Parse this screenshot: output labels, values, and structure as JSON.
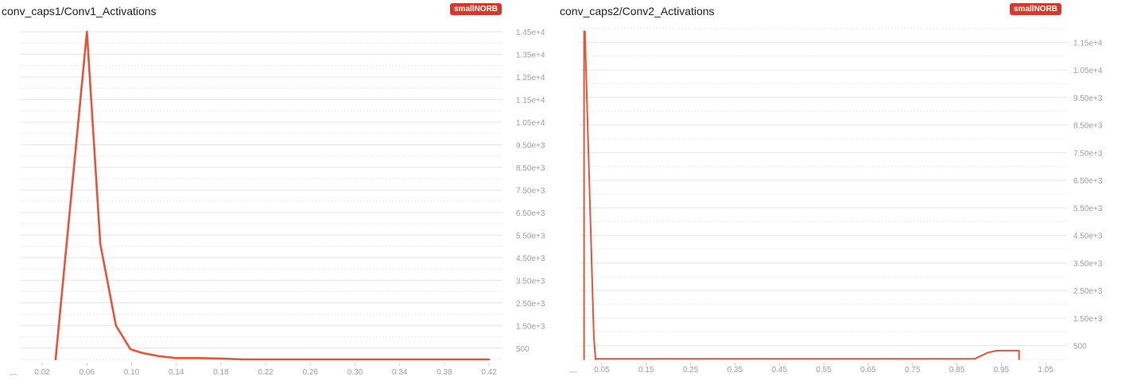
{
  "charts": [
    {
      "title": "conv_caps1/Conv1_Activations",
      "run_tag": "smallNORB",
      "tag_color": "#d13b2f"
    },
    {
      "title": "conv_caps2/Conv2_Activations",
      "run_tag": "smallNORB",
      "tag_color": "#d13b2f"
    }
  ],
  "chart_data": [
    {
      "type": "line",
      "title": "conv_caps1/Conv1_Activations",
      "xlabel": "",
      "ylabel": "",
      "xlim": [
        0.0,
        0.432
      ],
      "ylim": [
        0,
        14500
      ],
      "x_ticks": [
        0.02,
        0.06,
        0.1,
        0.14,
        0.18,
        0.22,
        0.26,
        0.3,
        0.34,
        0.38,
        0.42
      ],
      "x_tick_labels": [
        "0.02",
        "0.06",
        "0.10",
        "0.14",
        "0.18",
        "0.22",
        "0.26",
        "0.30",
        "0.34",
        "0.38",
        "0.42"
      ],
      "y_ticks": [
        500,
        1500,
        2500,
        3500,
        4500,
        5500,
        6500,
        7500,
        8500,
        9500,
        10500,
        11500,
        12500,
        13500,
        14500
      ],
      "y_tick_labels": [
        "500",
        "1.50e+3",
        "2.50e+3",
        "3.50e+3",
        "4.50e+3",
        "5.50e+3",
        "6.50e+3",
        "7.50e+3",
        "8.50e+3",
        "9.50e+3",
        "1.05e+4",
        "1.15e+4",
        "1.25e+4",
        "1.35e+4",
        "1.45e+4"
      ],
      "grid": true,
      "color": "#e8543a",
      "series": [
        {
          "x": [
            0.032,
            0.0325,
            0.06,
            0.072,
            0.086,
            0.099,
            0.11,
            0.125,
            0.14,
            0.16,
            0.18,
            0.2,
            0.42
          ],
          "values": [
            0,
            300,
            14500,
            5100,
            1500,
            450,
            280,
            140,
            60,
            60,
            40,
            0,
            0
          ]
        }
      ]
    },
    {
      "type": "line",
      "title": "conv_caps2/Conv2_Activations",
      "xlabel": "",
      "ylabel": "",
      "xlim": [
        0.0,
        1.098
      ],
      "ylim": [
        0,
        12000
      ],
      "x_ticks": [
        0.05,
        0.15,
        0.25,
        0.35,
        0.45,
        0.55,
        0.65,
        0.75,
        0.85,
        0.95,
        1.05
      ],
      "x_tick_labels": [
        "0.05",
        "0.15",
        "0.25",
        "0.35",
        "0.45",
        "0.55",
        "0.65",
        "0.75",
        "0.85",
        "0.95",
        "1.05"
      ],
      "y_ticks": [
        500,
        1500,
        2500,
        3500,
        4500,
        5500,
        6500,
        7500,
        8500,
        9500,
        10500,
        11500
      ],
      "y_tick_labels": [
        "500",
        "1.50e+3",
        "2.50e+3",
        "3.50e+3",
        "4.50e+3",
        "5.50e+3",
        "6.50e+3",
        "7.50e+3",
        "8.50e+3",
        "9.50e+3",
        "1.05e+4",
        "1.15e+4"
      ],
      "grid": true,
      "color": "#e8543a",
      "series": [
        {
          "x": [
            0.01,
            0.01,
            0.012,
            0.032,
            0.036,
            0.036,
            0.89,
            0.92,
            0.94,
            0.99,
            0.99
          ],
          "values": [
            0,
            11900,
            11900,
            800,
            0,
            20,
            20,
            250,
            320,
            320,
            0
          ]
        }
      ]
    }
  ]
}
